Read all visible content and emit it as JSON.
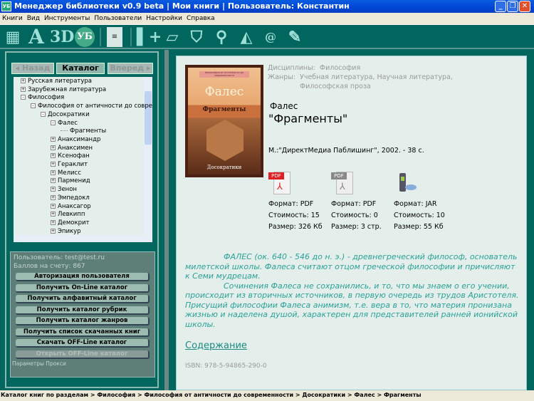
{
  "window": {
    "title": "Менеджер библиотеки v0.9 beta | Мои книги | Пользователь: Константин",
    "icon": "УБ"
  },
  "menu": [
    "Книги",
    "Вид",
    "Инструменты",
    "Пользователи",
    "Настройки",
    "Справка"
  ],
  "nav": {
    "back": "◂ Назад",
    "catalog": "Каталог",
    "forward": "Вперед ▸"
  },
  "tree": [
    {
      "label": "Русская литература",
      "level": 0,
      "state": "+"
    },
    {
      "label": "Зарубежная литература",
      "level": 0,
      "state": "+"
    },
    {
      "label": "Философия",
      "level": 0,
      "state": "-"
    },
    {
      "label": "Философия от античности до совре",
      "level": 1,
      "state": "-"
    },
    {
      "label": "Досократики",
      "level": 2,
      "state": "-"
    },
    {
      "label": "Фалес",
      "level": 3,
      "state": "-"
    },
    {
      "label": "Фрагменты",
      "level": 4,
      "state": ""
    },
    {
      "label": "Анаксимандр",
      "level": 3,
      "state": "+"
    },
    {
      "label": "Анаксимен",
      "level": 3,
      "state": "+"
    },
    {
      "label": "Ксенофан",
      "level": 3,
      "state": "+"
    },
    {
      "label": "Гераклит",
      "level": 3,
      "state": "+"
    },
    {
      "label": "Мелисс",
      "level": 3,
      "state": "+"
    },
    {
      "label": "Парменид",
      "level": 3,
      "state": "+"
    },
    {
      "label": "Зенон",
      "level": 3,
      "state": "+"
    },
    {
      "label": "Эмпедокл",
      "level": 3,
      "state": "+"
    },
    {
      "label": "Анаксагор",
      "level": 3,
      "state": "+"
    },
    {
      "label": "Левкипп",
      "level": 3,
      "state": "+"
    },
    {
      "label": "Демокрит",
      "level": 3,
      "state": "+"
    },
    {
      "label": "Эпикур",
      "level": 3,
      "state": "+"
    }
  ],
  "user": {
    "email": "Пользователь: test@test.ru",
    "points": "Баллов на счету: 867",
    "buttons": [
      {
        "label": "Авторизация пользователя",
        "disabled": false
      },
      {
        "label": "Получить On-Line каталог",
        "disabled": false
      },
      {
        "label": "Получить алфавитный каталог",
        "disabled": false
      },
      {
        "label": "Получить каталог рубрик",
        "disabled": false
      },
      {
        "label": "Получить каталог жанров",
        "disabled": false
      },
      {
        "label": "Получить список скачанных книг",
        "disabled": false
      },
      {
        "label": "Скачать OFF-Line каталог",
        "disabled": false
      },
      {
        "label": "Открыть OFF-Line каталог",
        "disabled": true
      }
    ],
    "proxy": "Параметры Прокси"
  },
  "book": {
    "cover": {
      "top": "Философия от античности до современности",
      "author": "Фалес",
      "title": "Фрагменты",
      "series": "Досократики"
    },
    "disciplines_label": "Дисциплины:",
    "disciplines": "Философия",
    "genres_label": "Жанры:",
    "genres_line1": "Учебная литература,  Научная литература,",
    "genres_line2": "Философская проза",
    "author": "Фалес",
    "title": "\"Фрагменты\"",
    "publisher": "М.:\"ДиректМедиа Паблишинг\", 2002. - 38 с.",
    "formats": [
      {
        "icon": "pdf-icon",
        "format": "Формат: PDF",
        "cost": "Стоимость: 15",
        "size": "Размер: 326 Кб"
      },
      {
        "icon": "pdf-gray-icon",
        "format": "Формат: PDF",
        "cost": "Стоимость: 0",
        "size": "Размер: 3 стр."
      },
      {
        "icon": "mobile-phone-icon",
        "format": "Формат: JAR",
        "cost": "Стоимость: 10",
        "size": "Размер: 55 Кб"
      }
    ],
    "description": [
      "ФАЛЕС (ок. 640 - 546 до н. э.) - древнегреческий философ, основатель милетской школы. Фалеса считают отцом греческой философии и причисляют к Семи мудрецам.",
      "Сочинения Фалеса не сохранились, и то, что мы знаем о его учении, происходит из вторичных источников, в первую очередь из трудов Аристотеля. Присущий философии Фалеса анимизм, т.е. вера в то, что материя пронизана жизнью и наделена душой, характерен для представителей ранней ионийской школы."
    ],
    "toc_link": "Содержание",
    "isbn": "ISBN: 978-5-94865-290-0"
  },
  "status": "Каталог книг по разделам > Философия > Философия от античности до современности > Досократики > Фалес > Фрагменты"
}
